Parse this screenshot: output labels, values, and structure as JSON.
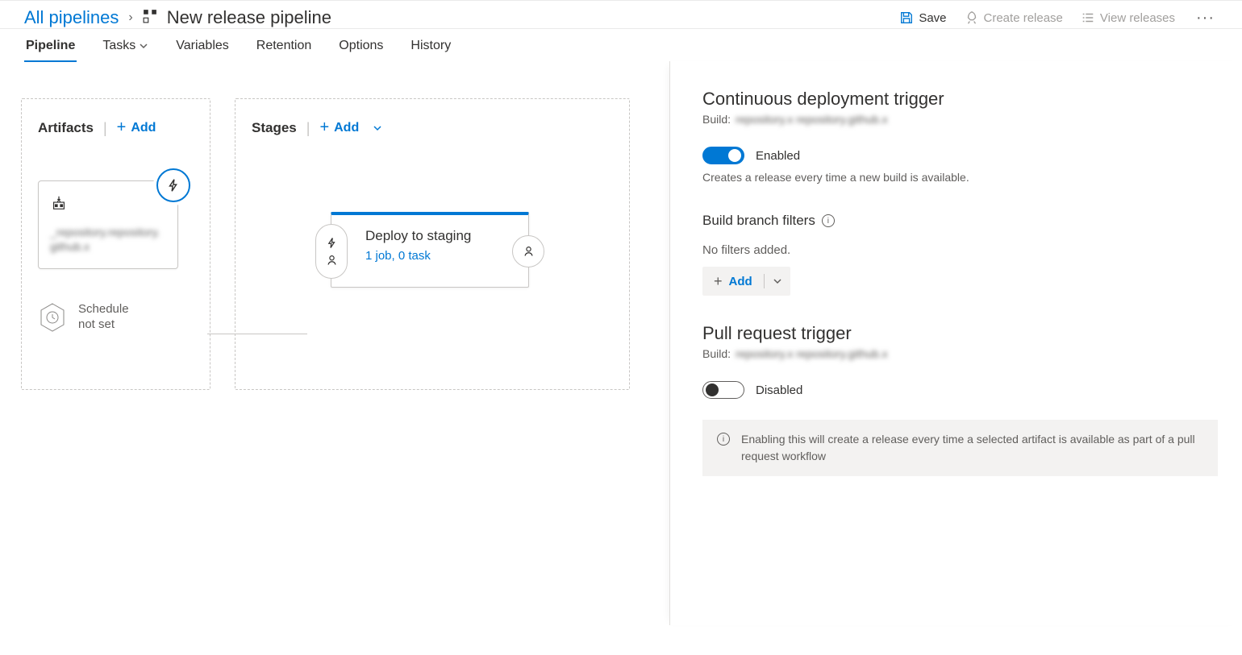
{
  "breadcrumb": {
    "root": "All pipelines"
  },
  "page_title": "New release pipeline",
  "header_actions": {
    "save": "Save",
    "create_release": "Create release",
    "view_releases": "View releases"
  },
  "tabs": [
    "Pipeline",
    "Tasks",
    "Variables",
    "Retention",
    "Options",
    "History"
  ],
  "artifacts": {
    "title": "Artifacts",
    "add": "Add",
    "card_name": "_repository.repository.github.x",
    "schedule": "Schedule\nnot set"
  },
  "stages": {
    "title": "Stages",
    "add": "Add",
    "stage_name": "Deploy to staging",
    "stage_sub": "1 job, 0 task"
  },
  "cd_trigger": {
    "title": "Continuous deployment trigger",
    "build_label": "Build:",
    "build_value": "repository.x repository.github.x",
    "toggle_state": "Enabled",
    "desc": "Creates a release every time a new build is available."
  },
  "branch_filters": {
    "title": "Build branch filters",
    "empty": "No filters added.",
    "add": "Add"
  },
  "pr_trigger": {
    "title": "Pull request trigger",
    "build_label": "Build:",
    "build_value": "repository.x repository.github.x",
    "toggle_state": "Disabled",
    "info": "Enabling this will create a release every time a selected artifact is available as part of a pull request workflow"
  }
}
